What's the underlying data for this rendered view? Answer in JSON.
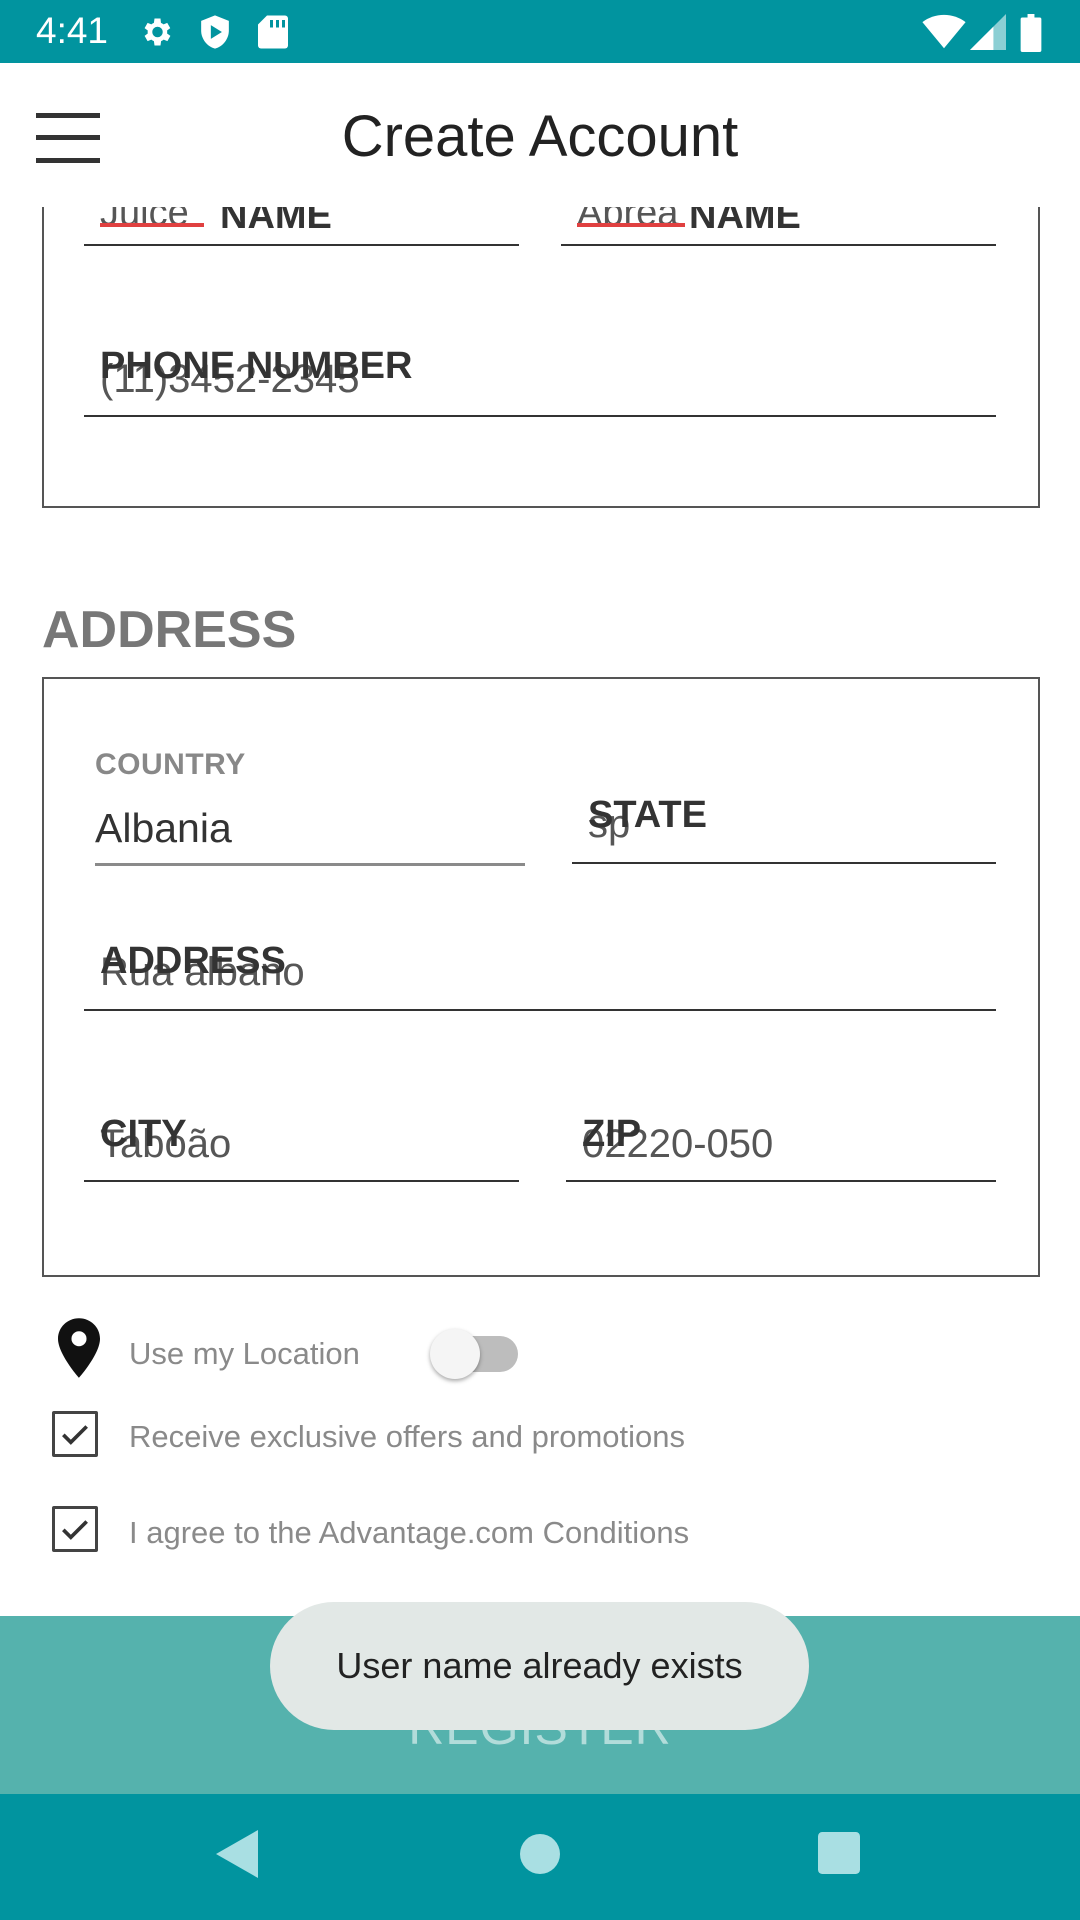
{
  "status_bar": {
    "time": "4:41",
    "icons": [
      "settings-icon",
      "shield-play-icon",
      "sd-card-icon",
      "wifi-icon",
      "signal-icon",
      "battery-icon"
    ],
    "color": "#01949f"
  },
  "app_bar": {
    "title": "Create Account",
    "menu_icon": "hamburger-menu-icon"
  },
  "account_details": {
    "first_name_label": "NAME",
    "first_name_value": "Juice",
    "last_name_label": "NAME",
    "last_name_value": "Abrea",
    "phone_label": "PHONE NUMBER",
    "phone_value": "(11)3452-2345"
  },
  "address": {
    "section_title": "ADDRESS",
    "country_label": "COUNTRY",
    "country_value": "Albania",
    "state_label": "STATE",
    "state_value": "sp",
    "address_label": "ADDRESS",
    "address_value": "Rua albano",
    "city_label": "CITY",
    "city_value": "Taboão",
    "zip_label": "ZIP",
    "zip_value": "02220-050"
  },
  "options": {
    "use_location_label": "Use my Location",
    "use_location_on": false,
    "offers_label": "Receive exclusive offers and promotions",
    "offers_checked": true,
    "conditions_label": "I agree to the Advantage.com Conditions",
    "conditions_checked": true
  },
  "register_button": {
    "label": "REGISTER",
    "color": "#55b2ad"
  },
  "toast": {
    "message": "User name already exists"
  },
  "nav_bar": {
    "icons": [
      "back-icon",
      "home-icon",
      "recents-icon"
    ]
  }
}
